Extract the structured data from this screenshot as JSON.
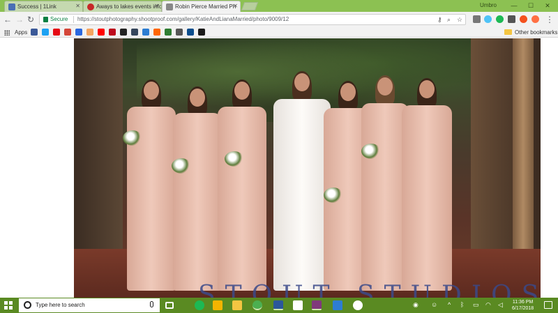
{
  "browser": {
    "tabs": [
      {
        "label": "Success | 1Link",
        "color": "#4a6fb5",
        "active": false
      },
      {
        "label": "Aways to lakes events info",
        "color": "#c62828",
        "active": false
      },
      {
        "label": "Robin Pierce Married Ph",
        "color": "#888888",
        "active": true
      }
    ],
    "window_user": "Umbro",
    "omnibox": {
      "security": "Secure",
      "url": "https://stoutphotography.shootproof.com/gallery/KatieAndLianaMarried/photo/9009/12"
    },
    "bookmarks": {
      "apps_label": "Apps",
      "other_label": "Other bookmarks",
      "icons": [
        {
          "name": "facebook",
          "color": "#3b5998"
        },
        {
          "name": "twitter",
          "color": "#1da1f2"
        },
        {
          "name": "netflix",
          "color": "#e50914"
        },
        {
          "name": "gmail",
          "color": "#d44638"
        },
        {
          "name": "pandora",
          "color": "#2a68e0"
        },
        {
          "name": "bookmark",
          "color": "#f4a460"
        },
        {
          "name": "youtube",
          "color": "#ff0000"
        },
        {
          "name": "pinterest",
          "color": "#bd081c"
        },
        {
          "name": "imdb",
          "color": "#222222"
        },
        {
          "name": "tumblr",
          "color": "#35465c"
        },
        {
          "name": "bookmark",
          "color": "#2d7dd2"
        },
        {
          "name": "bookmark",
          "color": "#ff6600"
        },
        {
          "name": "bookmark",
          "color": "#2e7d32"
        },
        {
          "name": "bookmark",
          "color": "#555555"
        },
        {
          "name": "bookmark",
          "color": "#0a4d8c"
        },
        {
          "name": "bookmark",
          "color": "#1a1a1a"
        }
      ]
    }
  },
  "page": {
    "watermark": "STOUT STUDIOS"
  },
  "taskbar": {
    "search_placeholder": "Type here to search",
    "clock_time": "11:36 PM",
    "clock_date": "6/17/2018",
    "apps": [
      {
        "name": "task-view",
        "color": "#ffffff"
      },
      {
        "name": "spotify",
        "color": "#1db954"
      },
      {
        "name": "store",
        "color": "#f4b400"
      },
      {
        "name": "file-explorer",
        "color": "#f4c542"
      },
      {
        "name": "chrome",
        "color": "#4caf50"
      },
      {
        "name": "word",
        "color": "#2b579a"
      },
      {
        "name": "sticky-notes",
        "color": "#ffffff"
      },
      {
        "name": "onenote",
        "color": "#80397b"
      },
      {
        "name": "messaging",
        "color": "#2d7dd2"
      },
      {
        "name": "app",
        "color": "#ffffff"
      }
    ]
  }
}
